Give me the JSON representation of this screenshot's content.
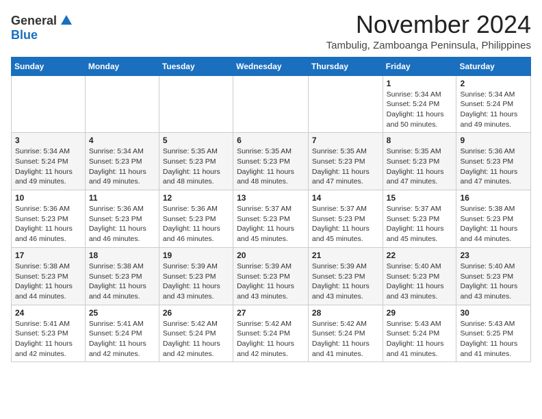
{
  "logo": {
    "general": "General",
    "blue": "Blue"
  },
  "title": {
    "month": "November 2024",
    "location": "Tambulig, Zamboanga Peninsula, Philippines"
  },
  "weekdays": [
    "Sunday",
    "Monday",
    "Tuesday",
    "Wednesday",
    "Thursday",
    "Friday",
    "Saturday"
  ],
  "weeks": [
    [
      {
        "day": "",
        "info": ""
      },
      {
        "day": "",
        "info": ""
      },
      {
        "day": "",
        "info": ""
      },
      {
        "day": "",
        "info": ""
      },
      {
        "day": "",
        "info": ""
      },
      {
        "day": "1",
        "info": "Sunrise: 5:34 AM\nSunset: 5:24 PM\nDaylight: 11 hours\nand 50 minutes."
      },
      {
        "day": "2",
        "info": "Sunrise: 5:34 AM\nSunset: 5:24 PM\nDaylight: 11 hours\nand 49 minutes."
      }
    ],
    [
      {
        "day": "3",
        "info": "Sunrise: 5:34 AM\nSunset: 5:24 PM\nDaylight: 11 hours\nand 49 minutes."
      },
      {
        "day": "4",
        "info": "Sunrise: 5:34 AM\nSunset: 5:23 PM\nDaylight: 11 hours\nand 49 minutes."
      },
      {
        "day": "5",
        "info": "Sunrise: 5:35 AM\nSunset: 5:23 PM\nDaylight: 11 hours\nand 48 minutes."
      },
      {
        "day": "6",
        "info": "Sunrise: 5:35 AM\nSunset: 5:23 PM\nDaylight: 11 hours\nand 48 minutes."
      },
      {
        "day": "7",
        "info": "Sunrise: 5:35 AM\nSunset: 5:23 PM\nDaylight: 11 hours\nand 47 minutes."
      },
      {
        "day": "8",
        "info": "Sunrise: 5:35 AM\nSunset: 5:23 PM\nDaylight: 11 hours\nand 47 minutes."
      },
      {
        "day": "9",
        "info": "Sunrise: 5:36 AM\nSunset: 5:23 PM\nDaylight: 11 hours\nand 47 minutes."
      }
    ],
    [
      {
        "day": "10",
        "info": "Sunrise: 5:36 AM\nSunset: 5:23 PM\nDaylight: 11 hours\nand 46 minutes."
      },
      {
        "day": "11",
        "info": "Sunrise: 5:36 AM\nSunset: 5:23 PM\nDaylight: 11 hours\nand 46 minutes."
      },
      {
        "day": "12",
        "info": "Sunrise: 5:36 AM\nSunset: 5:23 PM\nDaylight: 11 hours\nand 46 minutes."
      },
      {
        "day": "13",
        "info": "Sunrise: 5:37 AM\nSunset: 5:23 PM\nDaylight: 11 hours\nand 45 minutes."
      },
      {
        "day": "14",
        "info": "Sunrise: 5:37 AM\nSunset: 5:23 PM\nDaylight: 11 hours\nand 45 minutes."
      },
      {
        "day": "15",
        "info": "Sunrise: 5:37 AM\nSunset: 5:23 PM\nDaylight: 11 hours\nand 45 minutes."
      },
      {
        "day": "16",
        "info": "Sunrise: 5:38 AM\nSunset: 5:23 PM\nDaylight: 11 hours\nand 44 minutes."
      }
    ],
    [
      {
        "day": "17",
        "info": "Sunrise: 5:38 AM\nSunset: 5:23 PM\nDaylight: 11 hours\nand 44 minutes."
      },
      {
        "day": "18",
        "info": "Sunrise: 5:38 AM\nSunset: 5:23 PM\nDaylight: 11 hours\nand 44 minutes."
      },
      {
        "day": "19",
        "info": "Sunrise: 5:39 AM\nSunset: 5:23 PM\nDaylight: 11 hours\nand 43 minutes."
      },
      {
        "day": "20",
        "info": "Sunrise: 5:39 AM\nSunset: 5:23 PM\nDaylight: 11 hours\nand 43 minutes."
      },
      {
        "day": "21",
        "info": "Sunrise: 5:39 AM\nSunset: 5:23 PM\nDaylight: 11 hours\nand 43 minutes."
      },
      {
        "day": "22",
        "info": "Sunrise: 5:40 AM\nSunset: 5:23 PM\nDaylight: 11 hours\nand 43 minutes."
      },
      {
        "day": "23",
        "info": "Sunrise: 5:40 AM\nSunset: 5:23 PM\nDaylight: 11 hours\nand 43 minutes."
      }
    ],
    [
      {
        "day": "24",
        "info": "Sunrise: 5:41 AM\nSunset: 5:23 PM\nDaylight: 11 hours\nand 42 minutes."
      },
      {
        "day": "25",
        "info": "Sunrise: 5:41 AM\nSunset: 5:24 PM\nDaylight: 11 hours\nand 42 minutes."
      },
      {
        "day": "26",
        "info": "Sunrise: 5:42 AM\nSunset: 5:24 PM\nDaylight: 11 hours\nand 42 minutes."
      },
      {
        "day": "27",
        "info": "Sunrise: 5:42 AM\nSunset: 5:24 PM\nDaylight: 11 hours\nand 42 minutes."
      },
      {
        "day": "28",
        "info": "Sunrise: 5:42 AM\nSunset: 5:24 PM\nDaylight: 11 hours\nand 41 minutes."
      },
      {
        "day": "29",
        "info": "Sunrise: 5:43 AM\nSunset: 5:24 PM\nDaylight: 11 hours\nand 41 minutes."
      },
      {
        "day": "30",
        "info": "Sunrise: 5:43 AM\nSunset: 5:25 PM\nDaylight: 11 hours\nand 41 minutes."
      }
    ]
  ]
}
